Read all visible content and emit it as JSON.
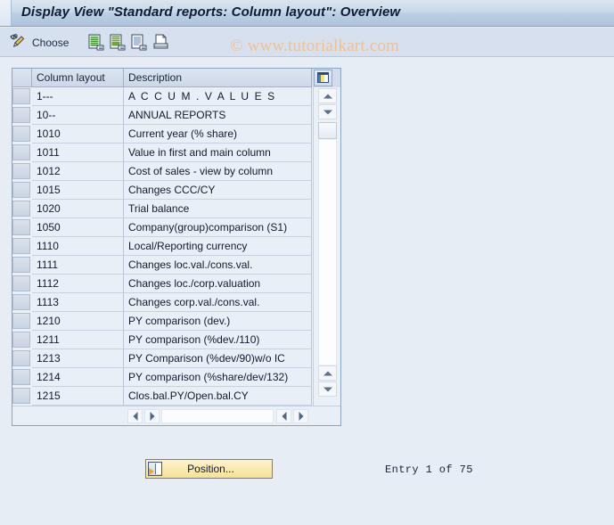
{
  "window": {
    "title": "Display View \"Standard reports: Column layout\": Overview"
  },
  "watermark": {
    "text": "© www.tutorialkart.com",
    "color": "#f0c191"
  },
  "toolbar": {
    "choose_label": "Choose",
    "icons": [
      {
        "name": "choose-pencil-icon"
      },
      {
        "name": "details-document-green-icon"
      },
      {
        "name": "display-document-green-icon"
      },
      {
        "name": "document-lines-icon"
      },
      {
        "name": "print-icon"
      }
    ]
  },
  "table": {
    "columns": [
      "Column layout",
      "Description"
    ],
    "config_icon": "column-configuration-icon",
    "rows": [
      {
        "layout": "1---",
        "description": "A C C U M .   V A L U E S",
        "spaced": true
      },
      {
        "layout": "10--",
        "description": "ANNUAL REPORTS",
        "spaced": false
      },
      {
        "layout": "1010",
        "description": "Current year (% share)",
        "spaced": false
      },
      {
        "layout": "1011",
        "description": "Value in first and main column",
        "spaced": false
      },
      {
        "layout": "1012",
        "description": "Cost of sales - view by column",
        "spaced": false
      },
      {
        "layout": "1015",
        "description": "Changes CCC/CY",
        "spaced": false
      },
      {
        "layout": "1020",
        "description": "Trial balance",
        "spaced": false
      },
      {
        "layout": "1050",
        "description": "Company(group)comparison  (S1)",
        "spaced": false
      },
      {
        "layout": "1110",
        "description": "Local/Reporting currency",
        "spaced": false
      },
      {
        "layout": "1111",
        "description": "Changes loc.val./cons.val.",
        "spaced": false
      },
      {
        "layout": "1112",
        "description": "Changes loc./corp.valuation",
        "spaced": false
      },
      {
        "layout": "1113",
        "description": "Changes corp.val./cons.val.",
        "spaced": false
      },
      {
        "layout": "1210",
        "description": "PY comparison (dev.)",
        "spaced": false
      },
      {
        "layout": "1211",
        "description": "PY comparison (%dev./110)",
        "spaced": false
      },
      {
        "layout": "1213",
        "description": "PY Comparison (%dev/90)w/o IC",
        "spaced": false
      },
      {
        "layout": "1214",
        "description": "PY comparison (%share/dev/132)",
        "spaced": false
      },
      {
        "layout": "1215",
        "description": "Clos.bal.PY/Open.bal.CY",
        "spaced": false
      }
    ]
  },
  "footer": {
    "position_button_label": "Position...",
    "entry_status": "Entry 1 of 75"
  }
}
